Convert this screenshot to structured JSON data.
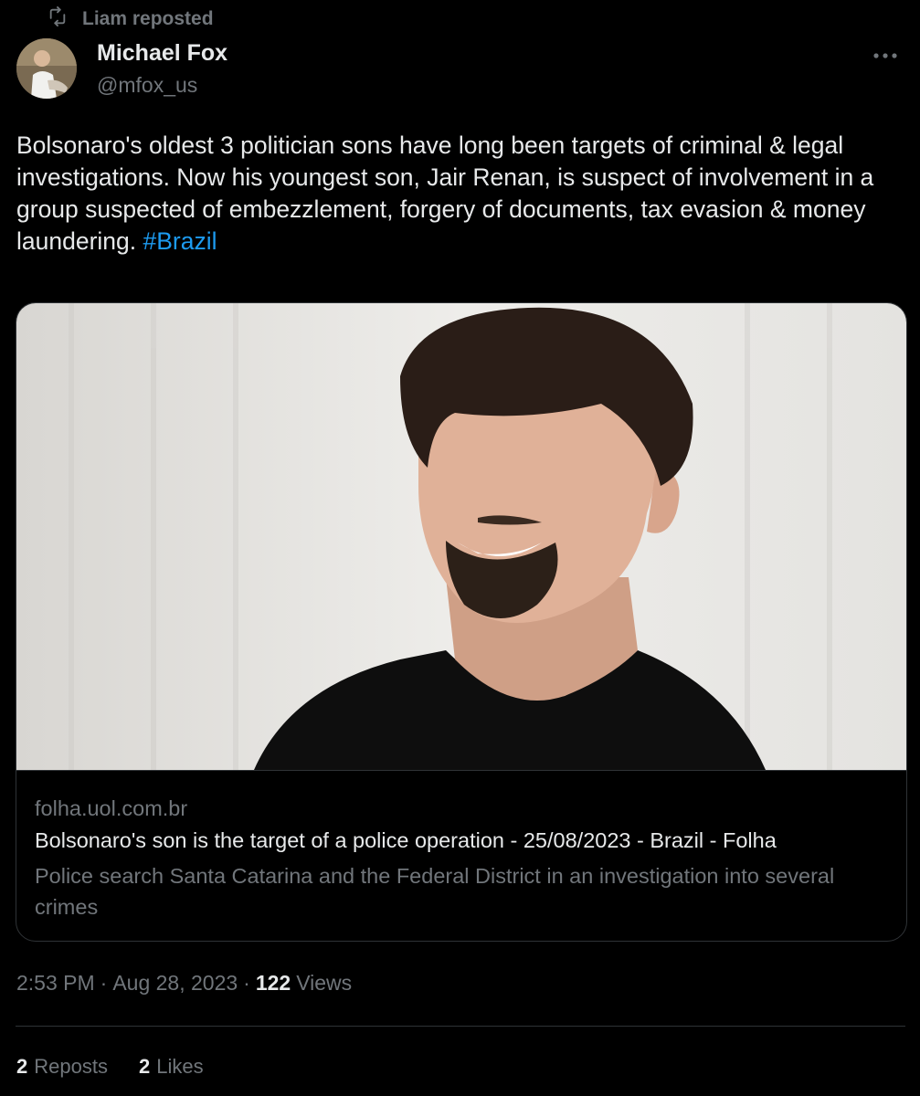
{
  "repost": {
    "text": "Liam reposted",
    "icon": "repost-icon"
  },
  "author": {
    "name": "Michael Fox",
    "handle": "@mfox_us"
  },
  "tweet": {
    "text": "Bolsonaro's oldest 3 politician sons have long been targets of criminal & legal investigations. Now his youngest son, Jair Renan, is suspect of involvement in a group suspected of embezzlement, forgery of documents, tax evasion & money laundering. ",
    "hashtag": "#Brazil"
  },
  "card": {
    "domain": "folha.uol.com.br",
    "title": "Bolsonaro's son is the target of a police operation - 25/08/2023 - Brazil - Folha",
    "description": "Police search Santa Catarina and the Federal District in an investigation into several crimes"
  },
  "meta": {
    "time": "2:53 PM",
    "separator": "·",
    "date": "Aug 28, 2023",
    "views_count": "122",
    "views_label": "Views"
  },
  "stats": {
    "reposts_count": "2",
    "reposts_label": "Reposts",
    "likes_count": "2",
    "likes_label": "Likes"
  },
  "colors": {
    "background": "#000000",
    "text": "#e7e9ea",
    "muted": "#71767b",
    "link": "#1d9bf0",
    "border": "#2f3336"
  }
}
